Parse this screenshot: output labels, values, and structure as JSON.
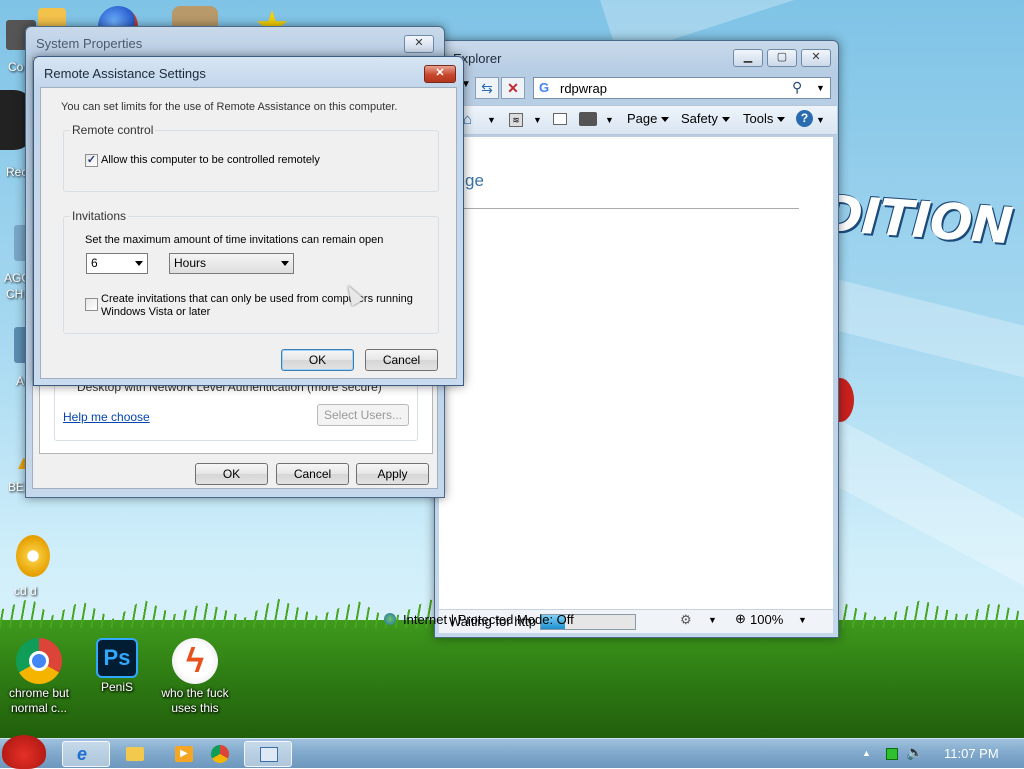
{
  "desktop": {
    "wallpaper_text": "S EDITION",
    "icons": [
      {
        "label": "Co",
        "name": "desktop-icon-co"
      },
      {
        "label": "Rec",
        "name": "desktop-icon-rec"
      },
      {
        "label": "AGC",
        "name": "desktop-icon-agc"
      },
      {
        "label": "CH",
        "name": "desktop-icon-ch"
      },
      {
        "label": "A",
        "name": "desktop-icon-a"
      },
      {
        "label": "BE",
        "name": "desktop-icon-be"
      },
      {
        "label": "cd d",
        "name": "desktop-icon-cd"
      }
    ],
    "bottom_icons": [
      {
        "label": "chrome but normal c...",
        "icon": "chrome-icon"
      },
      {
        "label": "PeniS",
        "icon": "photoshop-icon",
        "badge": "Ps"
      },
      {
        "label": "who the fuck uses this",
        "icon": "flash-icon"
      }
    ]
  },
  "ie": {
    "title": "Explorer",
    "search_value": "rdpwrap",
    "toolbar": {
      "page": "Page",
      "safety": "Safety",
      "tools": "Tools"
    },
    "content_fragment": "ge",
    "status": {
      "text": "Waiting for http",
      "progress": 0.25,
      "zone": "Internet | Protected Mode: Off",
      "zoom": "100%"
    }
  },
  "system_properties": {
    "title": "System Properties",
    "partial_text": "Desktop with Network Level Authentication (more secure)",
    "help_link": "Help me choose",
    "select_users": "Select Users...",
    "ok": "OK",
    "cancel": "Cancel",
    "apply": "Apply"
  },
  "remote_assistance": {
    "title": "Remote Assistance Settings",
    "intro": "You can set limits for the use of Remote Assistance on this computer.",
    "remote_control_legend": "Remote control",
    "allow_control_label": "Allow this computer to be controlled remotely",
    "allow_control_checked": true,
    "invitations_legend": "Invitations",
    "max_time_label": "Set the maximum amount of time invitations can remain open",
    "amount_value": "6",
    "unit_value": "Hours",
    "vista_label_1": "Create invitations that can only be used from computers running",
    "vista_label_2": "Windows Vista or later",
    "vista_checked": false,
    "ok": "OK",
    "cancel": "Cancel"
  },
  "taskbar": {
    "clock": "11:07 PM"
  },
  "colors": {
    "accent": "#3c7fb1",
    "link": "#0645ad",
    "title_text": "#1b2a3a"
  }
}
